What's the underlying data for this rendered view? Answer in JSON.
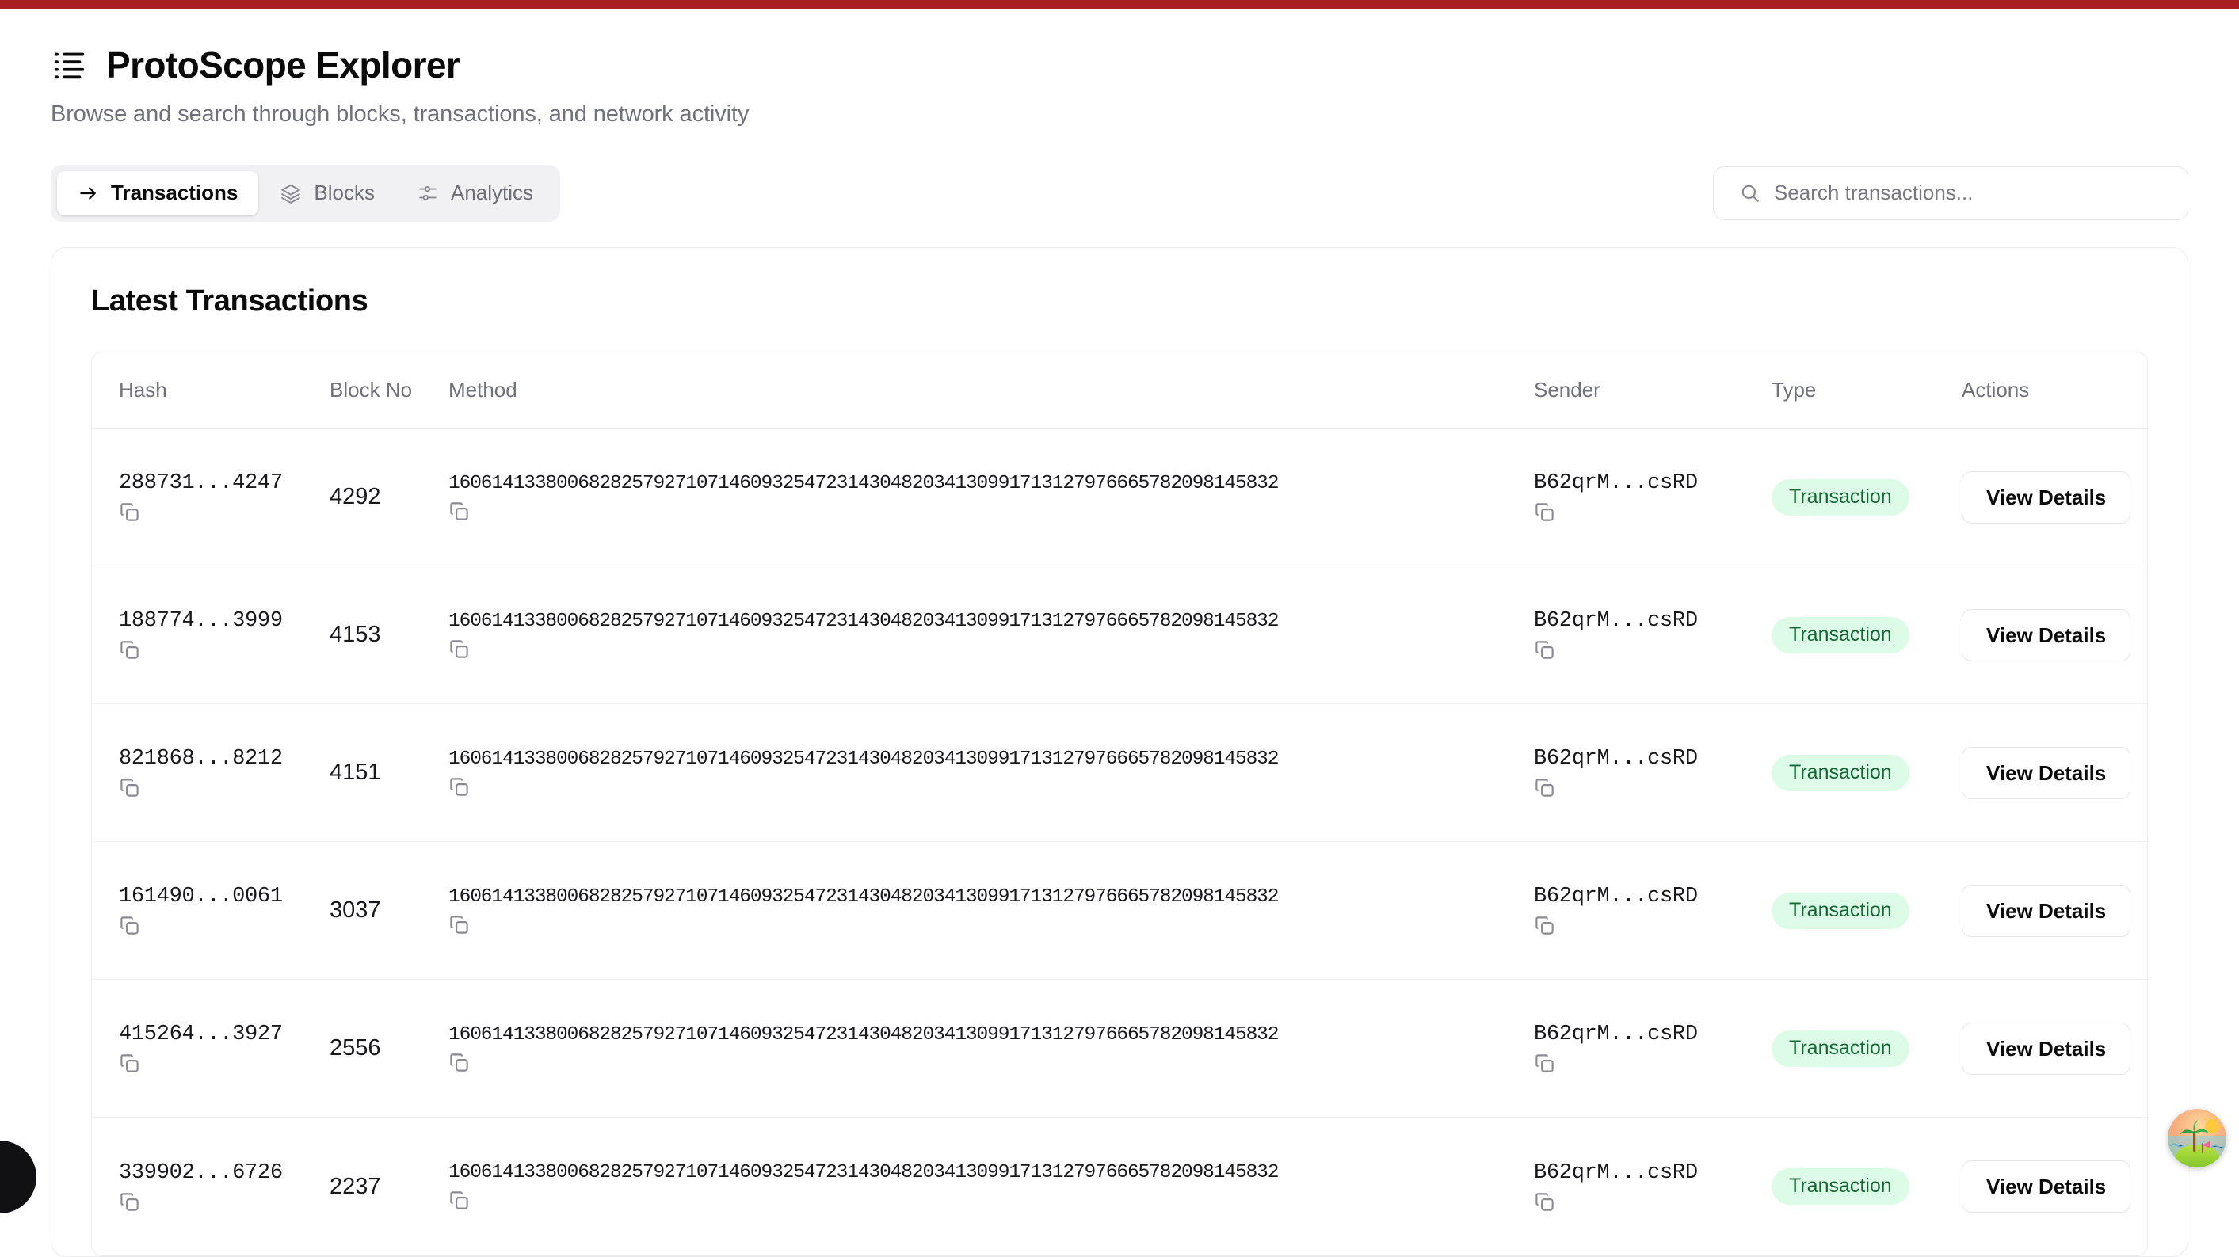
{
  "theme": {
    "accent_bar": "#a81f23",
    "badge_bg": "#dcfce7",
    "badge_text": "#166534",
    "muted_text": "#71717a"
  },
  "header": {
    "logo_icon": "list-icon",
    "title": "ProtoScope Explorer",
    "subtitle": "Browse and search through blocks, transactions, and network activity"
  },
  "toolbar": {
    "tabs": [
      {
        "label": "Transactions",
        "icon": "arrow-right-icon",
        "active": true
      },
      {
        "label": "Blocks",
        "icon": "layers-icon",
        "active": false
      },
      {
        "label": "Analytics",
        "icon": "sliders-icon",
        "active": false
      }
    ],
    "search": {
      "icon": "search-icon",
      "value": "",
      "placeholder": "Search transactions..."
    }
  },
  "main": {
    "card_title": "Latest Transactions",
    "table": {
      "columns": [
        "Hash",
        "Block No",
        "Method",
        "Sender",
        "Type",
        "Actions"
      ],
      "action_label": "View Details",
      "copy_icon": "copy-icon",
      "rows": [
        {
          "hash": "288731...4247",
          "block_no": "4292",
          "method": "16061413380068282579271071460932547231430482034130991713127976665782098145832",
          "sender": "B62qrM...csRD",
          "type": "Transaction"
        },
        {
          "hash": "188774...3999",
          "block_no": "4153",
          "method": "16061413380068282579271071460932547231430482034130991713127976665782098145832",
          "sender": "B62qrM...csRD",
          "type": "Transaction"
        },
        {
          "hash": "821868...8212",
          "block_no": "4151",
          "method": "16061413380068282579271071460932547231430482034130991713127976665782098145832",
          "sender": "B62qrM...csRD",
          "type": "Transaction"
        },
        {
          "hash": "161490...0061",
          "block_no": "3037",
          "method": "16061413380068282579271071460932547231430482034130991713127976665782098145832",
          "sender": "B62qrM...csRD",
          "type": "Transaction"
        },
        {
          "hash": "415264...3927",
          "block_no": "2556",
          "method": "16061413380068282579271071460932547231430482034130991713127976665782098145832",
          "sender": "B62qrM...csRD",
          "type": "Transaction"
        },
        {
          "hash": "339902...6726",
          "block_no": "2237",
          "method": "16061413380068282579271071460932547231430482034130991713127976665782098145832",
          "sender": "B62qrM...csRD",
          "type": "Transaction"
        }
      ]
    }
  },
  "overlays": {
    "floating_badge_icon": "beach-island-emoji",
    "corner_blob_icon": "dark-circle"
  }
}
